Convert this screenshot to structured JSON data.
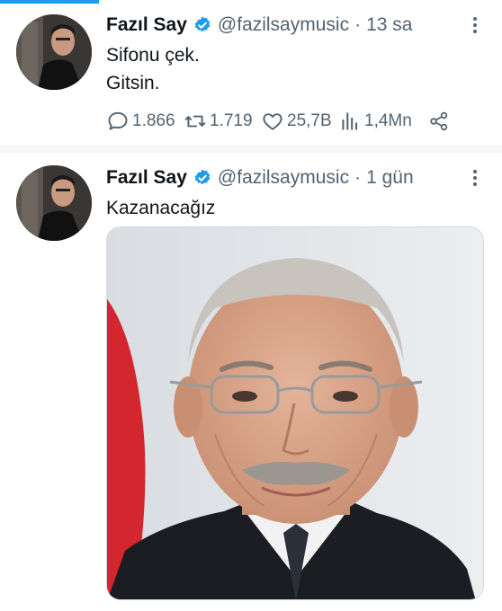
{
  "tweets": [
    {
      "author_name": "Fazıl Say",
      "handle": "@fazilsaymusic",
      "separator": "·",
      "time": "13 sa",
      "lines": [
        "Sifonu çek.",
        "Gitsin."
      ],
      "stats": {
        "replies": "1.866",
        "retweets": "1.719",
        "likes": "25,7B",
        "views": "1,4Mn"
      },
      "icons": [
        "verified-badge-icon",
        "more-options-icon",
        "reply-icon",
        "retweet-icon",
        "like-icon",
        "views-icon",
        "share-icon"
      ]
    },
    {
      "author_name": "Fazıl Say",
      "handle": "@fazilsaymusic",
      "separator": "·",
      "time": "1 gün",
      "lines": [
        "Kazanacağız"
      ],
      "media": "portrait-photo",
      "icons": [
        "verified-badge-icon",
        "more-options-icon"
      ]
    }
  ],
  "colors": {
    "accent": "#1d9bf0",
    "text_primary": "#0f1419",
    "text_secondary": "#536471",
    "divider": "#eff3f4"
  }
}
